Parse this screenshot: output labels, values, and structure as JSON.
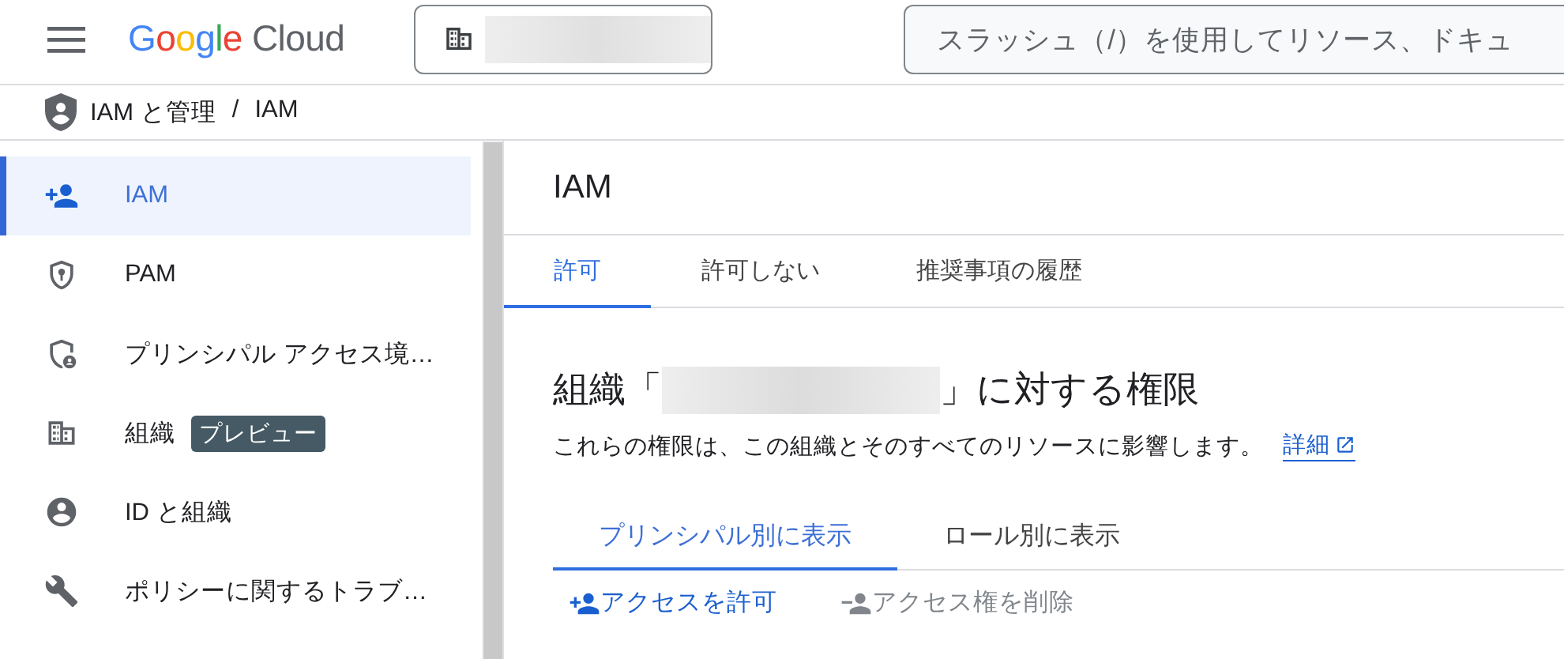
{
  "header": {
    "logo": {
      "brand": "Google",
      "product": "Cloud"
    },
    "search": {
      "placeholder": "スラッシュ（/）を使用してリソース、ドキュ"
    }
  },
  "breadcrumb": [
    "IAM と管理",
    "/",
    "IAM"
  ],
  "sidebar": {
    "items": [
      {
        "kind": "person-add",
        "label": "IAM",
        "selected": true
      },
      {
        "kind": "shield-key",
        "label": "PAM",
        "selected": false
      },
      {
        "kind": "shield-person",
        "label": "プリンシパル アクセス境…",
        "selected": false
      },
      {
        "kind": "building",
        "label": "組織",
        "selected": false,
        "badge": "プレビュー"
      },
      {
        "kind": "account",
        "label": "ID と組織",
        "selected": false
      },
      {
        "kind": "wrench",
        "label": "ポリシーに関するトラブ…",
        "selected": false
      }
    ]
  },
  "main": {
    "title": "IAM",
    "tabs": [
      {
        "label": "許可",
        "selected": true
      },
      {
        "label": "許可しない",
        "selected": false
      },
      {
        "label": "推奨事項の履歴",
        "selected": false
      }
    ],
    "heading": {
      "prefix": "組織「",
      "suffix": "」に対する権限"
    },
    "description": "これらの権限は、この組織とそのすべてのリソースに影響します。",
    "link": "詳細",
    "view_tabs": [
      {
        "label": "プリンシパル別に表示",
        "selected": true
      },
      {
        "label": "ロール別に表示",
        "selected": false
      }
    ],
    "actions": [
      {
        "kind": "add",
        "label": "アクセスを許可",
        "disabled": false
      },
      {
        "kind": "remove",
        "label": "アクセス権を削除",
        "disabled": true
      }
    ]
  }
}
